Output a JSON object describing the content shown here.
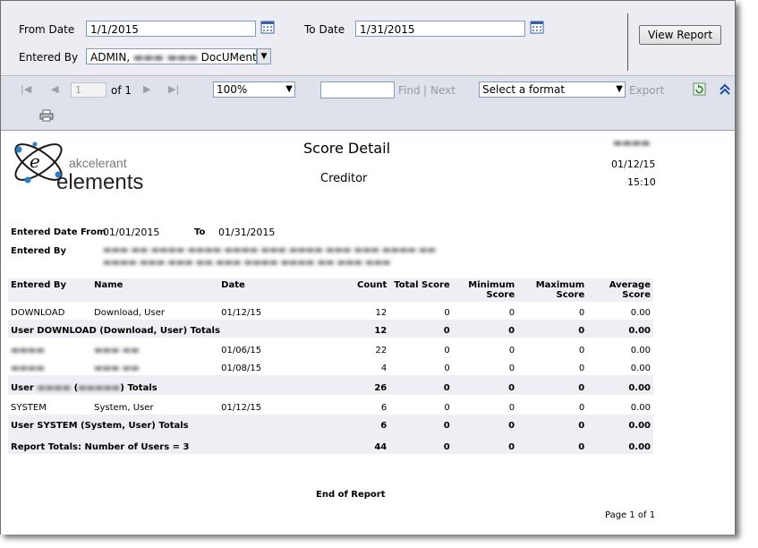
{
  "params": {
    "from_date_label": "From Date",
    "from_date_value": "1/1/2015",
    "to_date_label": "To Date",
    "to_date_value": "1/31/2015",
    "entered_by_label": "Entered By",
    "entered_by_value_prefix": "ADMIN,",
    "entered_by_value_suffix": "DocUMento",
    "view_report_label": "View Report"
  },
  "toolbar": {
    "page_number": "1",
    "page_of": "of 1",
    "zoom": "100%",
    "find_label": "Find",
    "separator": "|",
    "next_label": "Next",
    "format_placeholder": "Select a format",
    "export_label": "Export"
  },
  "report": {
    "logo_text_top": "akcelerant",
    "logo_text_bottom": "elements",
    "title": "Score Detail",
    "subtitle": "Creditor",
    "print_date": "01/12/15",
    "print_time": "15:10",
    "entered_date_from_label": "Entered Date From",
    "entered_date_from_value": "01/01/2015",
    "to_label": "To",
    "to_value": "01/31/2015",
    "entered_by_label": "Entered By",
    "columns": {
      "entered_by": "Entered By",
      "name": "Name",
      "date": "Date",
      "count": "Count",
      "total_score": "Total Score",
      "min_score_1": "Minimum",
      "min_score_2": "Score",
      "max_score_1": "Maximum",
      "max_score_2": "Score",
      "avg_score_1": "Average",
      "avg_score_2": "Score"
    },
    "rows": [
      {
        "entered_by": "DOWNLOAD",
        "name": "Download, User",
        "date": "01/12/15",
        "count": "12",
        "total": "0",
        "min": "0",
        "max": "0",
        "avg": "0.00"
      },
      {
        "total_row": true,
        "label": "User DOWNLOAD (Download, User) Totals",
        "count": "12",
        "total": "0",
        "min": "0",
        "max": "0",
        "avg": "0.00"
      },
      {
        "entered_by": "",
        "name": "",
        "date": "01/06/15",
        "count": "22",
        "total": "0",
        "min": "0",
        "max": "0",
        "avg": "0.00"
      },
      {
        "entered_by": "",
        "name": "",
        "date": "01/08/15",
        "count": "4",
        "total": "0",
        "min": "0",
        "max": "0",
        "avg": "0.00"
      },
      {
        "total_row": true,
        "label_prefix": "User",
        "label_mid": "(",
        "label_suffix": ") Totals",
        "count": "26",
        "total": "0",
        "min": "0",
        "max": "0",
        "avg": "0.00"
      },
      {
        "entered_by": "SYSTEM",
        "name": "System, User",
        "date": "01/12/15",
        "count": "6",
        "total": "0",
        "min": "0",
        "max": "0",
        "avg": "0.00"
      },
      {
        "total_row": true,
        "label": "User SYSTEM (System, User) Totals",
        "count": "6",
        "total": "0",
        "min": "0",
        "max": "0",
        "avg": "0.00"
      },
      {
        "total_row": true,
        "label": "Report Totals: Number of Users = 3",
        "count": "44",
        "total": "0",
        "min": "0",
        "max": "0",
        "avg": "0.00"
      }
    ],
    "end_of_report": "End of Report",
    "page_footer": "Page 1 of 1"
  }
}
